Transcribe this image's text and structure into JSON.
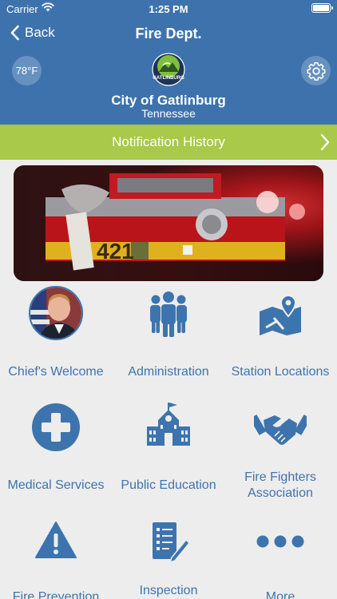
{
  "status_bar": {
    "carrier": "Carrier",
    "time": "1:25 PM"
  },
  "nav": {
    "back_label": "Back",
    "title": "Fire Dept."
  },
  "weather": {
    "temperature": "78°F"
  },
  "city": {
    "name": "City of Gatlinburg",
    "state": "Tennessee",
    "logo_text": "GATLINBURG"
  },
  "notification_bar": {
    "label": "Notification History"
  },
  "hero": {
    "truck_number": "421"
  },
  "menu": [
    {
      "label": "Chief's Welcome",
      "icon": "chief-photo"
    },
    {
      "label": "Administration",
      "icon": "people-group-icon"
    },
    {
      "label": "Station Locations",
      "icon": "map-marker-icon"
    },
    {
      "label": "Medical Services",
      "icon": "medical-cross-icon"
    },
    {
      "label": "Public Education",
      "icon": "school-icon"
    },
    {
      "label": "Fire Fighters Association",
      "icon": "handshake-icon"
    },
    {
      "label": "Fire Prevention",
      "icon": "warning-icon"
    },
    {
      "label": "Inspection",
      "icon": "document-pen-icon"
    },
    {
      "label": "More",
      "icon": "more-dots-icon"
    }
  ],
  "colors": {
    "header": "#3d72ad",
    "accent_green": "#a8c94a",
    "icon_blue": "#3e74ad",
    "background": "#ededed"
  }
}
